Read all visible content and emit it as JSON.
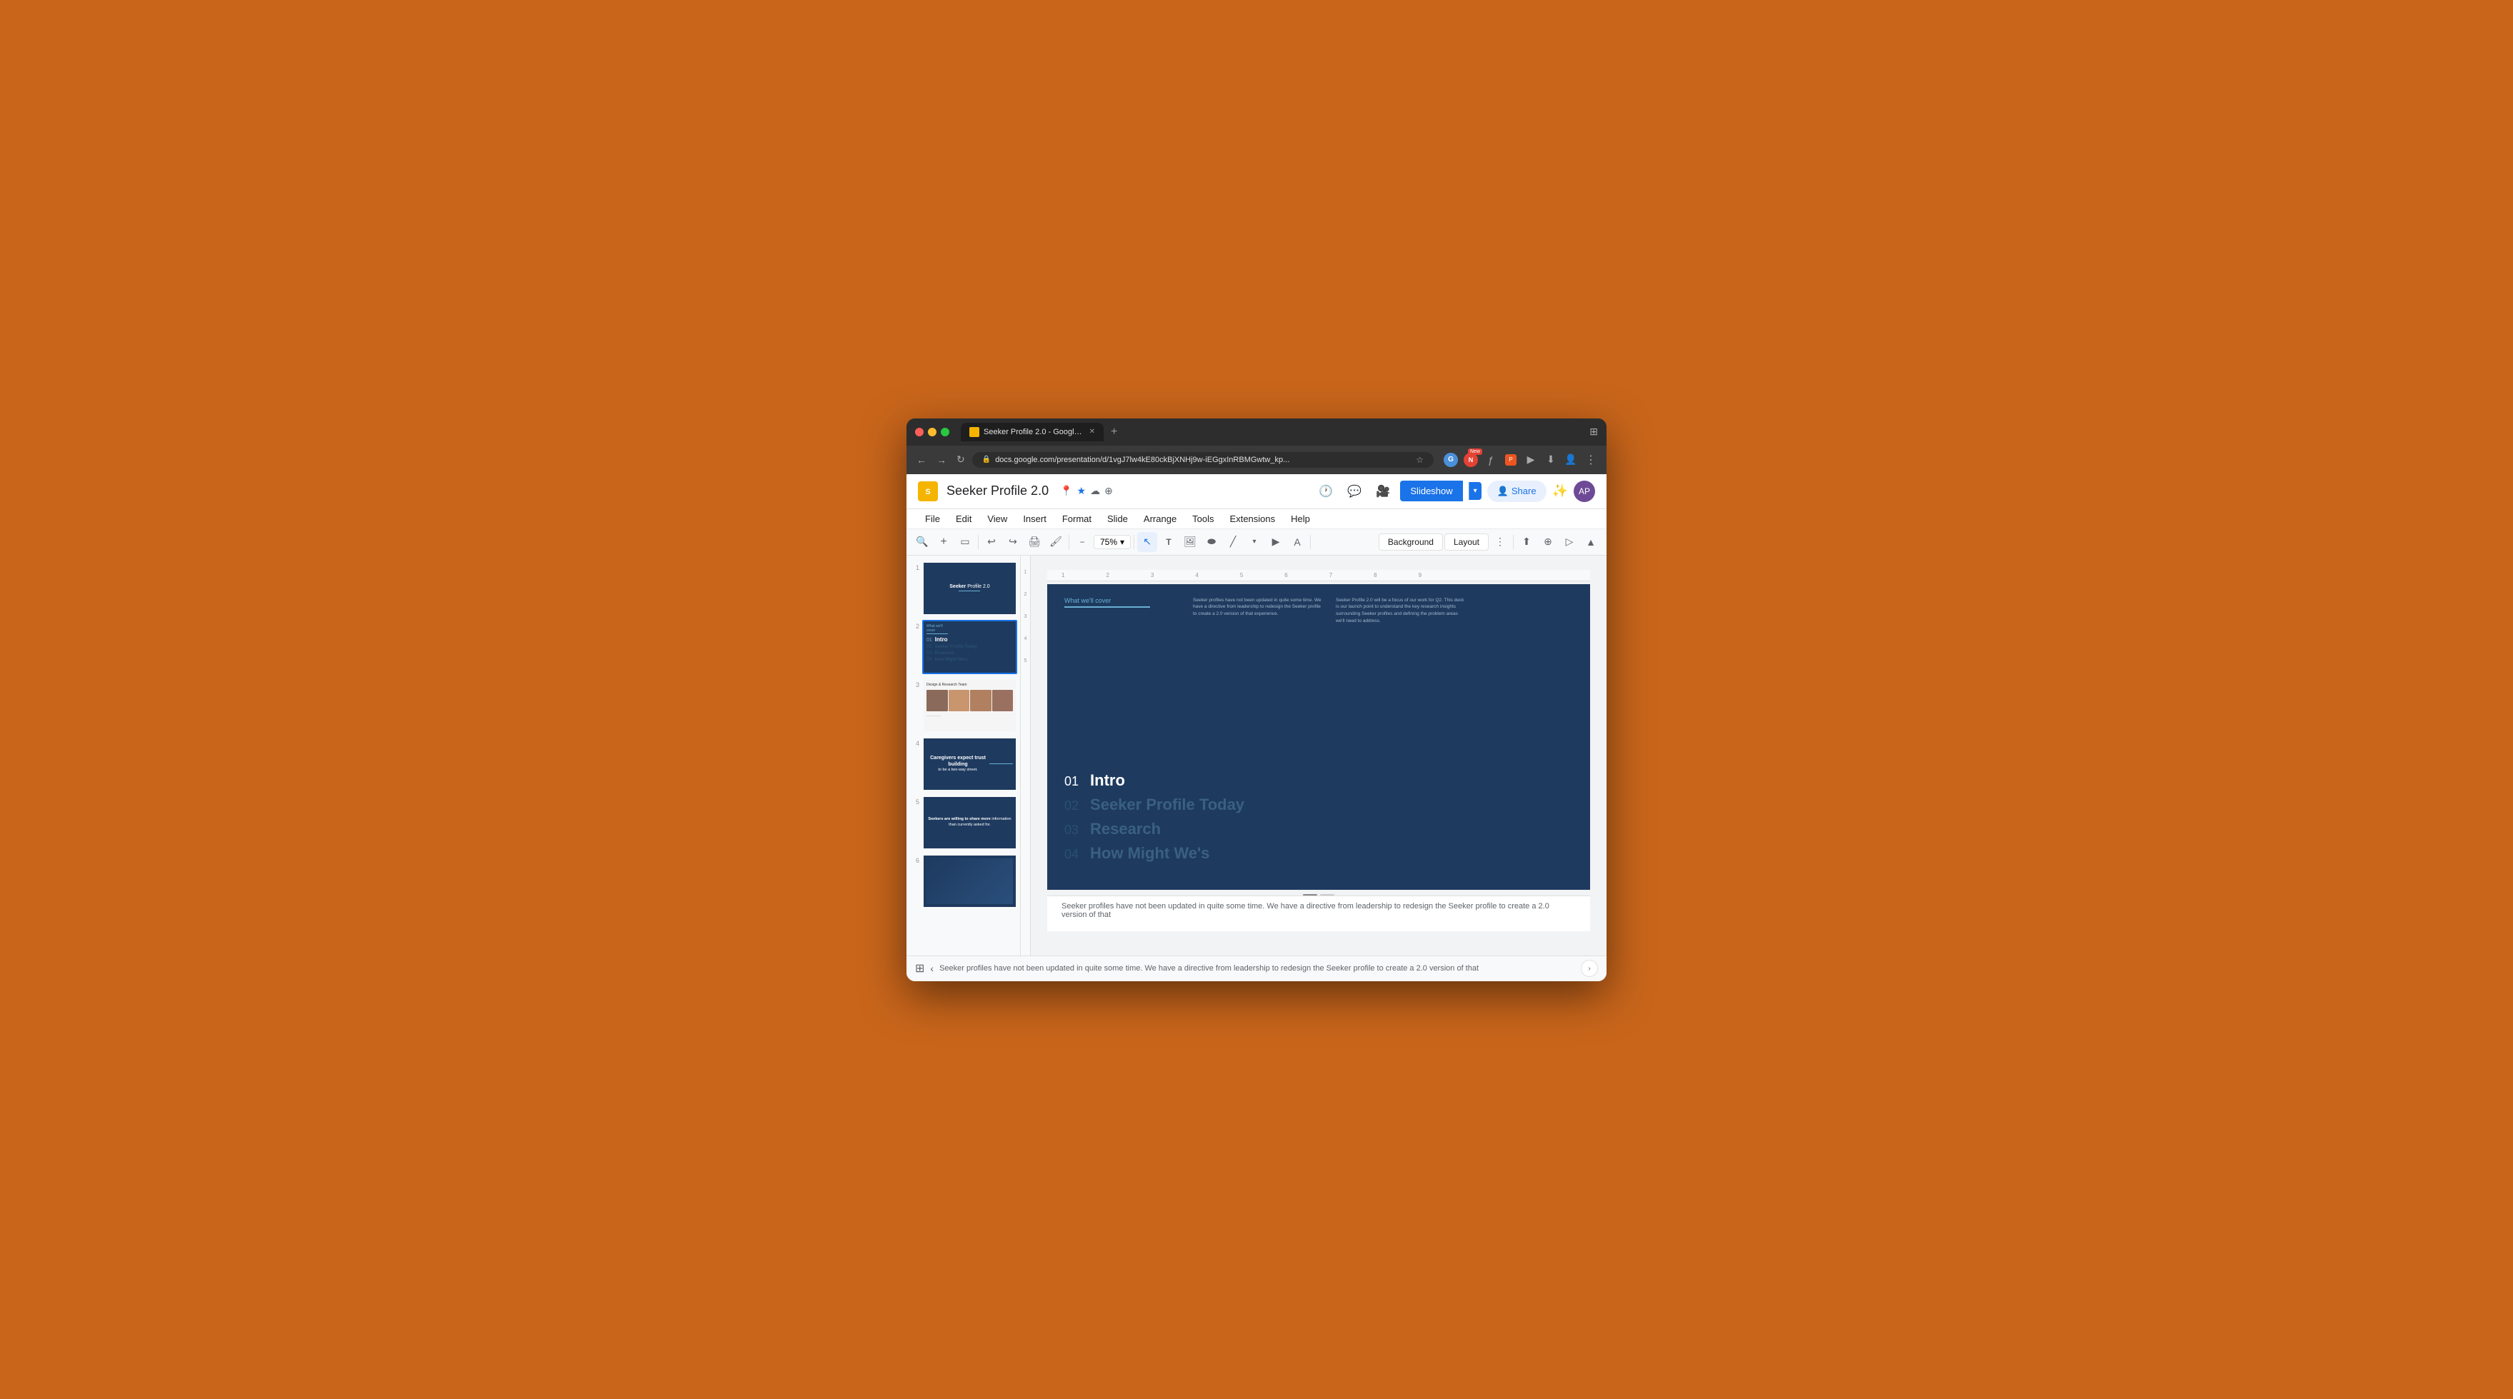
{
  "browser": {
    "tab_title": "Seeker Profile 2.0 - Google S",
    "new_tab_label": "+",
    "back_btn": "←",
    "forward_btn": "→",
    "refresh_btn": "↺",
    "url": "docs.google.com/presentation/d/1vgJ7lw4kE80ckBjXNHj9w-iEGgxInRBMGwtw_kp...",
    "more_btn": "⋮"
  },
  "app": {
    "title": "Seeker Profile 2.0",
    "logo_letter": "S",
    "menu": {
      "file": "File",
      "edit": "Edit",
      "view": "View",
      "insert": "Insert",
      "format": "Format",
      "slide": "Slide",
      "arrange": "Arrange",
      "tools": "Tools",
      "extensions": "Extensions",
      "help": "Help"
    },
    "toolbar": {
      "zoom": "75%",
      "background": "Background",
      "layout": "Layout"
    },
    "slideshow_btn": "Slideshow",
    "new_badge": "New"
  },
  "slides": [
    {
      "number": "1",
      "type": "title",
      "content": "Seeker Profile 2.0"
    },
    {
      "number": "2",
      "type": "intro",
      "content": "Intro slide - active"
    },
    {
      "number": "3",
      "type": "team",
      "content": "Design & Research Team"
    },
    {
      "number": "4",
      "type": "content",
      "content": "Caregivers expect trust building to be a two-way street."
    },
    {
      "number": "5",
      "type": "content",
      "content": "Seekers are willing to share more information than currently asked for."
    },
    {
      "number": "6",
      "type": "content",
      "content": "Slide 6"
    }
  ],
  "main_slide": {
    "what_we_cover": "What we'll cover",
    "para1": "Seeker profiles have not been updated in quite some time. We have a directive from leadership to redesign the Seeker profile to create a 2.0 version of that experience.",
    "para2": "Seeker Profile 2.0 will be a focus of our work for Q2. This deck is our launch point to understand the key research insights surrounding Seeker profiles and defining the problem areas we'll need to address.",
    "toc": [
      {
        "number": "01",
        "label": "Intro",
        "active": true
      },
      {
        "number": "02",
        "label": "Seeker Profile Today",
        "active": false
      },
      {
        "number": "03",
        "label": "Research",
        "active": false
      },
      {
        "number": "04",
        "label": "How Might We's",
        "active": false
      }
    ]
  },
  "speaker_notes": "Seeker profiles have not been updated in quite some time. We have a directive from leadership to redesign the Seeker profile to create a 2.0 version of that",
  "colors": {
    "slide_bg": "#1e3a5f",
    "accent_blue": "#6ab0d4",
    "text_dim": "#3a6080",
    "chrome_bg": "#2d2d2d"
  }
}
